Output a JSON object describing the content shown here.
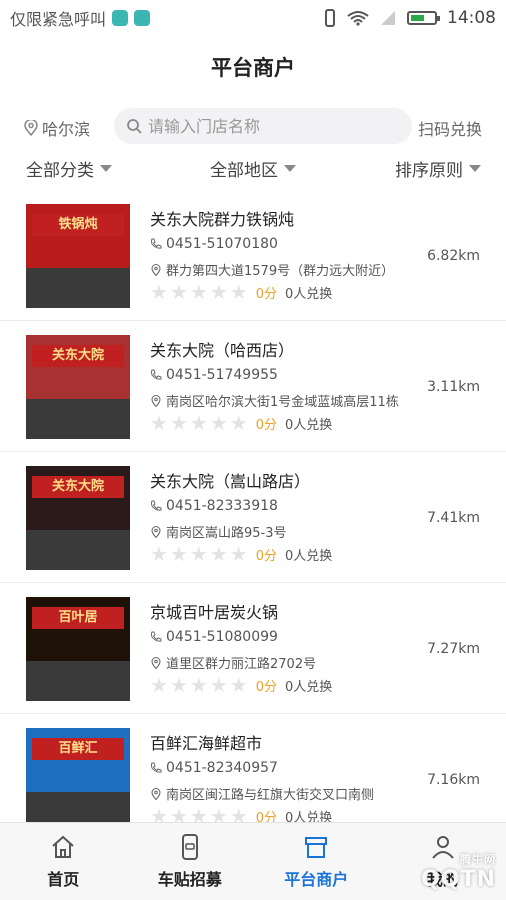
{
  "status_bar": {
    "carrier": "仅限紧急呼叫",
    "time": "14:08",
    "battery_level": 0.6
  },
  "header": {
    "title": "平台商户"
  },
  "search": {
    "city": "哈尔滨",
    "placeholder": "请输入门店名称",
    "scan_label": "扫码兑换"
  },
  "filters": {
    "category": "全部分类",
    "region": "全部地区",
    "sort": "排序原则"
  },
  "stores": [
    {
      "name": "关东大院群力铁锅炖",
      "phone": "0451-51070180",
      "address": "群力第四大道1579号（群力远大附近）",
      "score": "0分",
      "redeemed": "0人兑换",
      "distance": "6.82km",
      "rating": 0,
      "sign_text": "铁锅炖",
      "sign_color": "#b91c1c"
    },
    {
      "name": "关东大院（哈西店）",
      "phone": "0451-51749955",
      "address": "南岗区哈尔滨大街1号金域蓝城高层11栋",
      "score": "0分",
      "redeemed": "0人兑换",
      "distance": "3.11km",
      "rating": 0,
      "sign_text": "关东大院",
      "sign_color": "#a83232"
    },
    {
      "name": "关东大院（嵩山路店）",
      "phone": "0451-82333918",
      "address": "南岗区嵩山路95-3号",
      "score": "0分",
      "redeemed": "0人兑换",
      "distance": "7.41km",
      "rating": 0,
      "sign_text": "关东大院",
      "sign_color": "#2a1a1a"
    },
    {
      "name": "京城百叶居炭火锅",
      "phone": "0451-51080099",
      "address": "道里区群力丽江路2702号",
      "score": "0分",
      "redeemed": "0人兑换",
      "distance": "7.27km",
      "rating": 0,
      "sign_text": "百叶居",
      "sign_color": "#1e1208"
    },
    {
      "name": "百鲜汇海鲜超市",
      "phone": "0451-82340957",
      "address": "南岗区闽江路与红旗大街交叉口南侧",
      "score": "0分",
      "redeemed": "0人兑换",
      "distance": "7.16km",
      "rating": 0,
      "sign_text": "百鲜汇",
      "sign_color": "#1f6fc0"
    }
  ],
  "tabbar": {
    "tabs": [
      {
        "label": "首页",
        "icon": "home-icon"
      },
      {
        "label": "车贴招募",
        "icon": "phone-car-icon"
      },
      {
        "label": "平台商户",
        "icon": "store-icon",
        "active": true
      },
      {
        "label": "我的",
        "icon": "user-icon"
      }
    ]
  },
  "watermark": {
    "brand": "QQTN",
    "sub": "腾牛网"
  },
  "colors": {
    "accent": "#1a73d9",
    "score": "#f0a020"
  }
}
